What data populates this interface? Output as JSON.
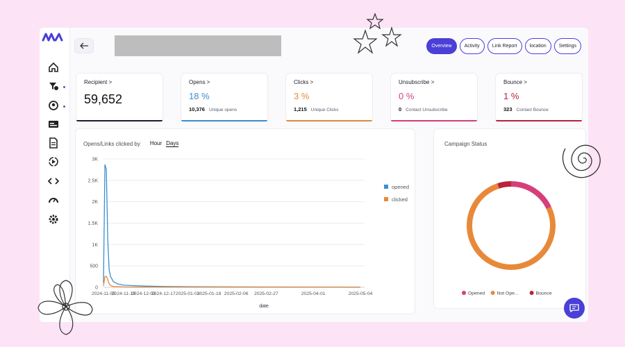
{
  "colors": {
    "accent": "#4a3fd6",
    "opens": "#3b8fd0",
    "clicks": "#e8893a",
    "unsubscribe": "#d6407a",
    "bounce": "#b8243a"
  },
  "sidebar": {
    "icons": [
      "home-icon",
      "campaign-icon",
      "audience-icon",
      "template-icon",
      "document-icon",
      "automation-icon",
      "code-icon",
      "speed-icon",
      "settings-icon"
    ]
  },
  "header": {
    "back_icon": "arrow-left-icon",
    "tabs": [
      {
        "label": "Overview",
        "active": true
      },
      {
        "label": "Activity",
        "active": false
      },
      {
        "label": "Link Report",
        "active": false
      },
      {
        "label": "location",
        "active": false
      },
      {
        "label": "Settings",
        "active": false
      }
    ]
  },
  "stats": {
    "recipient": {
      "label": "Recipient >",
      "value": "59,652"
    },
    "opens": {
      "label": "Opens >",
      "value": "18 %",
      "count": "10,376",
      "desc": "Unique opens"
    },
    "clicks": {
      "label": "Clicks >",
      "value": "3 %",
      "count": "1,215",
      "desc": "Unique Clicks"
    },
    "unsubscribe": {
      "label": "Unsubscribe >",
      "value": "0 %",
      "count": "0",
      "desc": "Contact Unsubscribe"
    },
    "bounce": {
      "label": "Bounce >",
      "value": "1 %",
      "count": "323",
      "desc": "Contact Bounce"
    }
  },
  "chart_panel": {
    "title": "Opens/Links clicked by",
    "options": [
      "Hour",
      "Days"
    ],
    "selected": "Days"
  },
  "status_panel": {
    "title": "Campaign Status"
  },
  "chat_icon": "chat-icon",
  "chart_data": [
    {
      "type": "line",
      "title": "",
      "xlabel": "date",
      "ylabel": "",
      "ylim": [
        0,
        3000
      ],
      "yticks": [
        "0",
        "500",
        "1K",
        "1.5K",
        "2K",
        "2.5K",
        "3K"
      ],
      "xticks": [
        "2024-11-05",
        "2024-11-19",
        "2024-12-03",
        "2024-12-17",
        "2025-01-03",
        "2025-01-18",
        "2025-02-06",
        "2025-02-27",
        "2025-04-01",
        "2025-05-04"
      ],
      "grid": true,
      "legend": "top-right",
      "series": [
        {
          "name": "opened",
          "color": "#3b8fd0",
          "x": [
            "2024-11-05",
            "2024-11-06",
            "2024-11-07",
            "2024-11-08",
            "2024-11-09",
            "2024-11-10",
            "2024-11-12",
            "2024-11-15",
            "2024-11-19",
            "2024-11-25",
            "2024-12-03",
            "2024-12-17",
            "2025-01-03",
            "2025-02-06",
            "2025-05-04"
          ],
          "y": [
            100,
            2870,
            2750,
            1100,
            400,
            250,
            130,
            80,
            50,
            40,
            30,
            20,
            15,
            10,
            5
          ]
        },
        {
          "name": "clicked",
          "color": "#e8893a",
          "x": [
            "2024-11-05",
            "2024-11-06",
            "2024-11-07",
            "2024-11-08",
            "2024-11-09",
            "2024-11-10",
            "2024-11-12",
            "2024-11-19",
            "2024-12-03",
            "2025-05-04"
          ],
          "y": [
            30,
            250,
            260,
            180,
            80,
            40,
            20,
            10,
            5,
            2
          ]
        }
      ]
    },
    {
      "type": "pie",
      "title": "Campaign Status",
      "legend": "bottom",
      "series": [
        {
          "name": "Opened",
          "value": 18,
          "color": "#d6407a"
        },
        {
          "name": "Not Ope...",
          "value": 77,
          "color": "#e8893a"
        },
        {
          "name": "Bounce",
          "value": 5,
          "color": "#b8243a"
        }
      ]
    }
  ]
}
